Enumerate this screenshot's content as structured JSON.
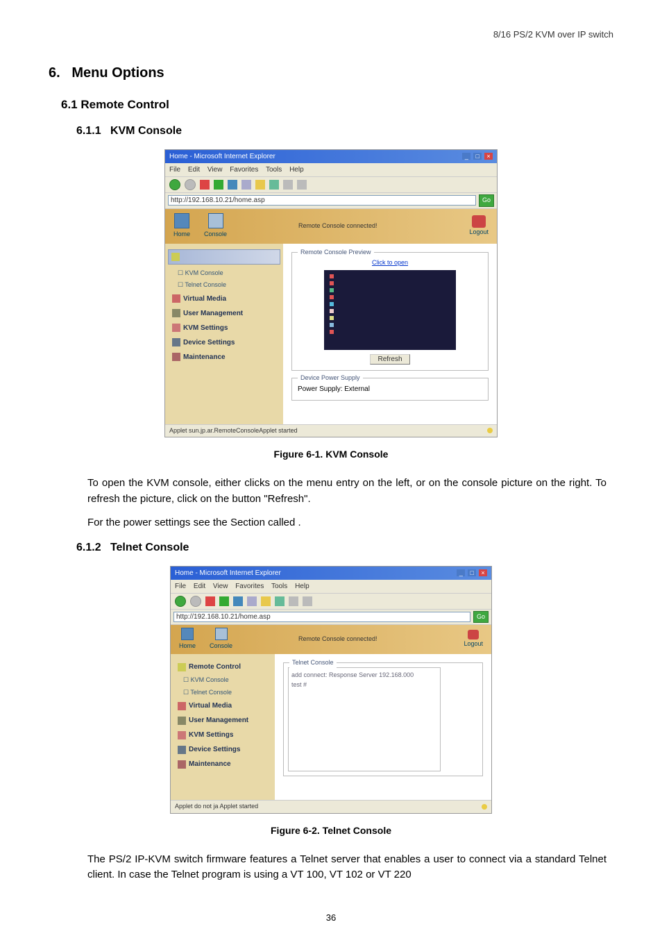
{
  "header": {
    "product": "8/16 PS/2 KVM over IP switch"
  },
  "section": {
    "number": "6.",
    "title": "Menu Options"
  },
  "sub1": {
    "number": "6.1",
    "title": "Remote Control"
  },
  "sub11": {
    "number": "6.1.1",
    "title": "KVM Console"
  },
  "sub12": {
    "number": "6.1.2",
    "title": "Telnet Console"
  },
  "fig1": {
    "caption": "Figure 6-1. KVM Console",
    "window_title": "Home - Microsoft Internet Explorer",
    "menu": {
      "file": "File",
      "edit": "Edit",
      "view": "View",
      "favorites": "Favorites",
      "tools": "Tools",
      "help": "Help"
    },
    "address": "http://192.168.10.21/home.asp",
    "go": "Go",
    "header_icons": {
      "home": "Home",
      "console": "Console",
      "logout": "Logout"
    },
    "header_status": "Remote Console connected!",
    "sidebar": {
      "kvm_console": "KVM Console",
      "telnet_console": "Telnet Console",
      "virtual_media": "Virtual Media",
      "user_management": "User Management",
      "kvm_settings": "KVM Settings",
      "device_settings": "Device Settings",
      "maintenance": "Maintenance"
    },
    "preview": {
      "legend": "Remote Console Preview",
      "click": "Click to open",
      "refresh": "Refresh"
    },
    "power": {
      "legend": "Device Power Supply",
      "label": "Power Supply:",
      "value": "External"
    },
    "status": "Applet sun.jp.ar.RemoteConsoleApplet started"
  },
  "para1": "To open the KVM console, either clicks on the menu entry on the left, or on the console picture on the right. To refresh the picture, click on the button \"Refresh\".",
  "para2": "For the power settings see the Section called              .",
  "fig2": {
    "caption": "Figure 6-2. Telnet Console",
    "window_title": "Home - Microsoft Internet Explorer",
    "menu": {
      "file": "File",
      "edit": "Edit",
      "view": "View",
      "favorites": "Favorites",
      "tools": "Tools",
      "help": "Help"
    },
    "address": "http://192.168.10.21/home.asp",
    "go": "Go",
    "header_icons": {
      "home": "Home",
      "console": "Console",
      "logout": "Logout"
    },
    "header_status": "Remote Console connected!",
    "sidebar": {
      "remote_control": "Remote Control",
      "kvm_console": "KVM Console",
      "telnet_console": "Telnet Console",
      "virtual_media": "Virtual Media",
      "user_management": "User Management",
      "kvm_settings": "KVM Settings",
      "device_settings": "Device Settings",
      "maintenance": "Maintenance"
    },
    "telnet": {
      "legend": "Telnet Console",
      "line1": "add connect: Response Server 192.168.000",
      "line2": "test #"
    },
    "status": "Applet do not ja Applet started"
  },
  "para3": "The PS/2 IP-KVM switch firmware features a Telnet server that enables a user to connect via a standard Telnet client. In case the Telnet program is using a VT 100, VT 102 or VT 220",
  "page": "36"
}
